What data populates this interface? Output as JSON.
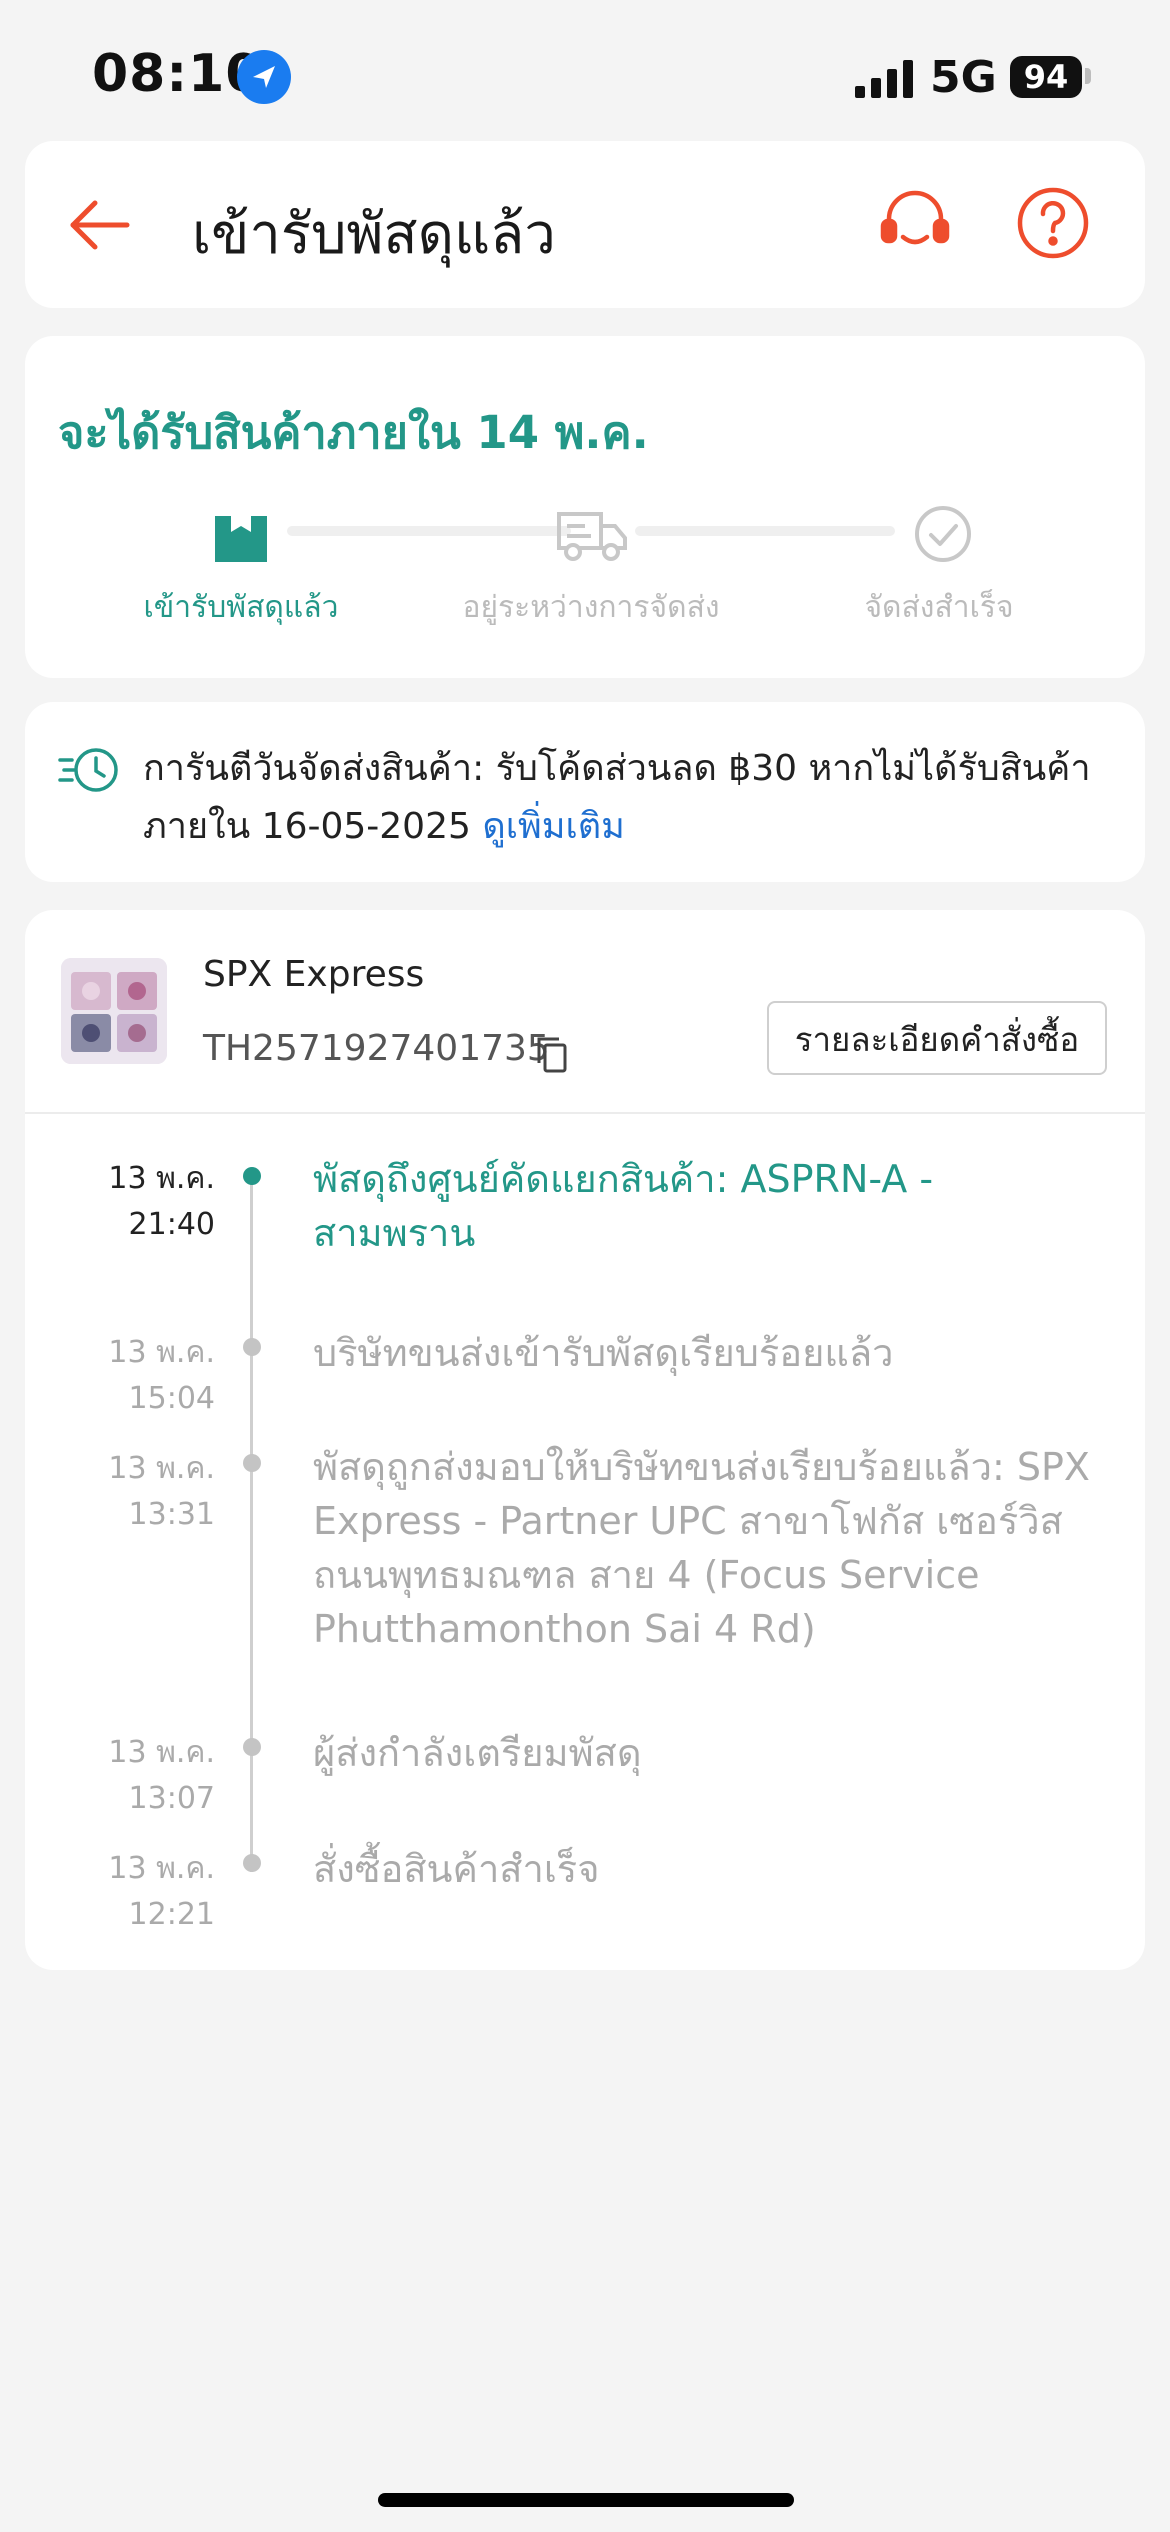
{
  "status_bar": {
    "time": "08:10",
    "network": "5G",
    "battery": "94"
  },
  "header": {
    "title": "เข้ารับพัสดุแล้ว"
  },
  "eta": {
    "text": "จะได้รับสินค้าภายใน 14 พ.ค.",
    "steps": [
      {
        "label": "เข้ารับพัสดุแล้ว",
        "state": "done",
        "icon": "package-icon"
      },
      {
        "label": "อยู่ระหว่างการจัดส่ง",
        "state": "pending",
        "icon": "truck-icon"
      },
      {
        "label": "จัดส่งสำเร็จ",
        "state": "pending",
        "icon": "check-circle-icon"
      }
    ]
  },
  "guarantee": {
    "text": "การันตีวันจัดส่งสินค้า: รับโค้ดส่วนลด ฿30 หากไม่ได้รับสินค้าภายใน 16-05-2025",
    "link": "ดูเพิ่มเติม"
  },
  "shipment": {
    "carrier": "SPX Express",
    "tracking_number": "TH2571927401735",
    "order_details_button": "รายละเอียดคำสั่งซื้อ"
  },
  "timeline": [
    {
      "date": "13 พ.ค.",
      "time": "21:40",
      "event": "พัสดุถึงศูนย์คัดแยกสินค้า: ASPRN-A - สามพราน",
      "active": true
    },
    {
      "date": "13 พ.ค.",
      "time": "15:04",
      "event": "บริษัทขนส่งเข้ารับพัสดุเรียบร้อยแล้ว",
      "active": false
    },
    {
      "date": "13 พ.ค.",
      "time": "13:31",
      "event": "พัสดุถูกส่งมอบให้บริษัทขนส่งเรียบร้อยแล้ว: SPX Express - Partner UPC สาขาโฟกัส เซอร์วิส ถนนพุทธมณฑล สาย 4 (Focus Service Phutthamonthon Sai 4 Rd)",
      "active": false
    },
    {
      "date": "13 พ.ค.",
      "time": "13:07",
      "event": " ผู้ส่งกำลังเตรียมพัสดุ",
      "active": false
    },
    {
      "date": "13 พ.ค.",
      "time": "12:21",
      "event": "สั่งซื้อสินค้าสำเร็จ",
      "active": false
    }
  ],
  "colors": {
    "accent": "#239788",
    "brand": "#ee4d2d",
    "link": "#1f6fd0"
  }
}
